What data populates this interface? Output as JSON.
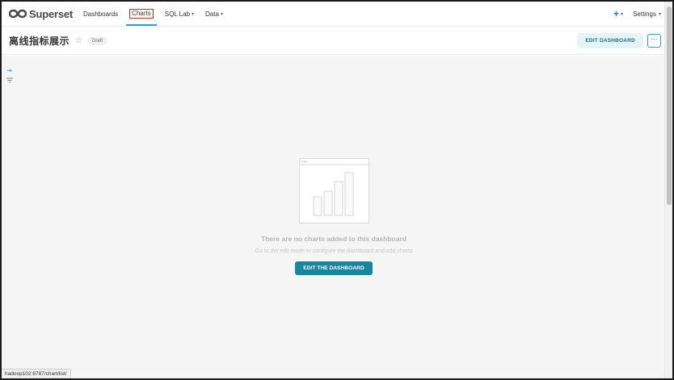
{
  "nav": {
    "brand": "Superset",
    "items": [
      {
        "label": "Dashboards",
        "has_caret": false
      },
      {
        "label": "Charts",
        "has_caret": false
      },
      {
        "label": "SQL Lab",
        "has_caret": true
      },
      {
        "label": "Data",
        "has_caret": true
      }
    ],
    "plus": "+",
    "caret": "▾",
    "settings": "Settings"
  },
  "header": {
    "title": "离线指标展示",
    "star": "☆",
    "status_badge": "Draft",
    "edit_button": "EDIT DASHBOARD",
    "more_button": "···"
  },
  "sidebar": {
    "collapse": "⇥",
    "filter": "⩸"
  },
  "empty_state": {
    "title": "There are no charts added to this dashboard",
    "subtitle": "Go to the edit mode to configure the dashboard and add charts",
    "button": "EDIT THE DASHBOARD"
  },
  "status_bar": {
    "url": "hadoop102:8787/chart/list/"
  },
  "colors": {
    "accent": "#20a7c9",
    "primary_button": "#1a85a0",
    "highlight_box": "#e02020"
  }
}
